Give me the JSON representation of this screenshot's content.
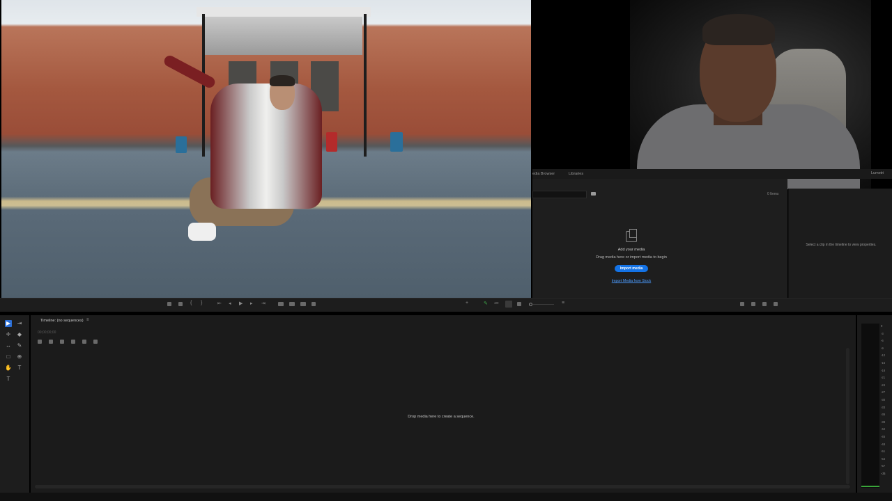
{
  "project_tabs": [
    "edia Browser",
    "Libraries"
  ],
  "lumetri_tab": "Lumetri",
  "project": {
    "items_count": "0 Items",
    "add_media": "Add your media",
    "drag_media": "Drag media here or import media to begin",
    "import_button": "Import media",
    "stock_link": "Import Media from Stock"
  },
  "properties": {
    "empty_text": "Select a clip in the timeline to view properties."
  },
  "timeline": {
    "title": "Timeline: (no sequences)",
    "menu_glyph": "≡",
    "timecode": "00;00;00;00",
    "drop_text": "Drop media here to create a sequence."
  },
  "meter": {
    "db_labels": [
      "0",
      "-3",
      "-6",
      "-9",
      "-12",
      "-15",
      "-18",
      "-21",
      "-24",
      "-27",
      "-30",
      "-33",
      "-36",
      "-39",
      "-42",
      "-45",
      "-48",
      "-51",
      "-54",
      "-57",
      "-dB"
    ],
    "level": 0
  },
  "tools": [
    {
      "name": "selection-tool",
      "glyph": "▶",
      "active": true
    },
    {
      "name": "track-select-tool",
      "glyph": "⇥",
      "active": false
    },
    {
      "name": "ripple-edit-tool",
      "glyph": "✛",
      "active": false
    },
    {
      "name": "razor-tool",
      "glyph": "◆",
      "active": false
    },
    {
      "name": "slip-tool",
      "glyph": "↔",
      "active": false
    },
    {
      "name": "pen-tool",
      "glyph": "✎",
      "active": false
    },
    {
      "name": "rectangle-tool",
      "glyph": "□",
      "active": false
    },
    {
      "name": "zoom-tool",
      "glyph": "⊕",
      "active": false
    },
    {
      "name": "hand-tool",
      "glyph": "✋",
      "active": false
    },
    {
      "name": "type-tool",
      "glyph": "T",
      "active": false
    },
    {
      "name": "vertical-type-tool",
      "glyph": "T",
      "active": false
    }
  ],
  "colors": {
    "accent": "#1473e6",
    "link": "#4b9cff",
    "panel": "#1e1e1e"
  }
}
